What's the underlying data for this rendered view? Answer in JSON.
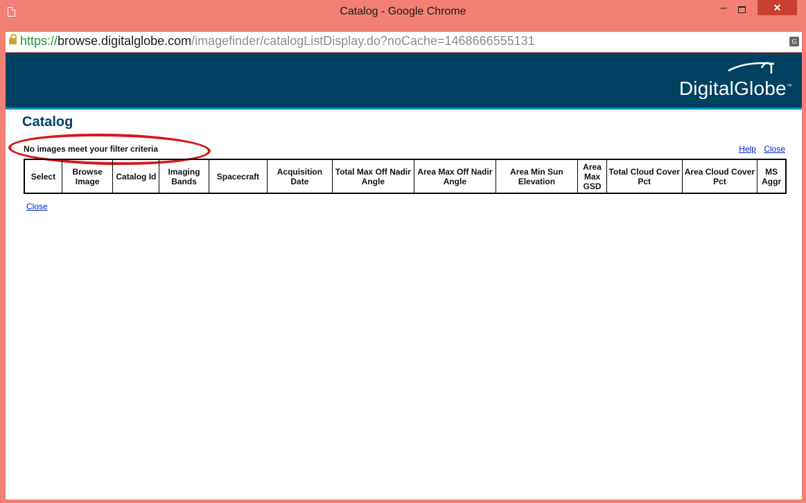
{
  "window": {
    "title": "Catalog - Google Chrome",
    "minimize_glyph": "–",
    "close_glyph": "✕"
  },
  "address": {
    "scheme": "https://",
    "host": "browse.digitalglobe.com",
    "path": "/imagefinder/catalogListDisplay.do?noCache=1468666555131"
  },
  "banner": {
    "logo": "DigitalGlobe",
    "brand_color": "#004162",
    "accent_color": "#0a8fc0"
  },
  "page": {
    "title": "Catalog",
    "filter_message": "No images meet your filter criteria",
    "help_link": "Help",
    "close_link": "Close",
    "bottom_close_link": "Close"
  },
  "table": {
    "columns": [
      "Select",
      "Browse Image",
      "Catalog Id",
      "Imaging Bands",
      "Spacecraft",
      "Acquisition Date",
      "Total Max Off Nadir Angle",
      "Area Max Off Nadir Angle",
      "Area Min Sun Elevation",
      "Area Max GSD",
      "Total Cloud Cover Pct",
      "Area Cloud Cover Pct",
      "MS Aggr"
    ]
  },
  "annotation": {
    "oval_color": "#d8171a"
  }
}
